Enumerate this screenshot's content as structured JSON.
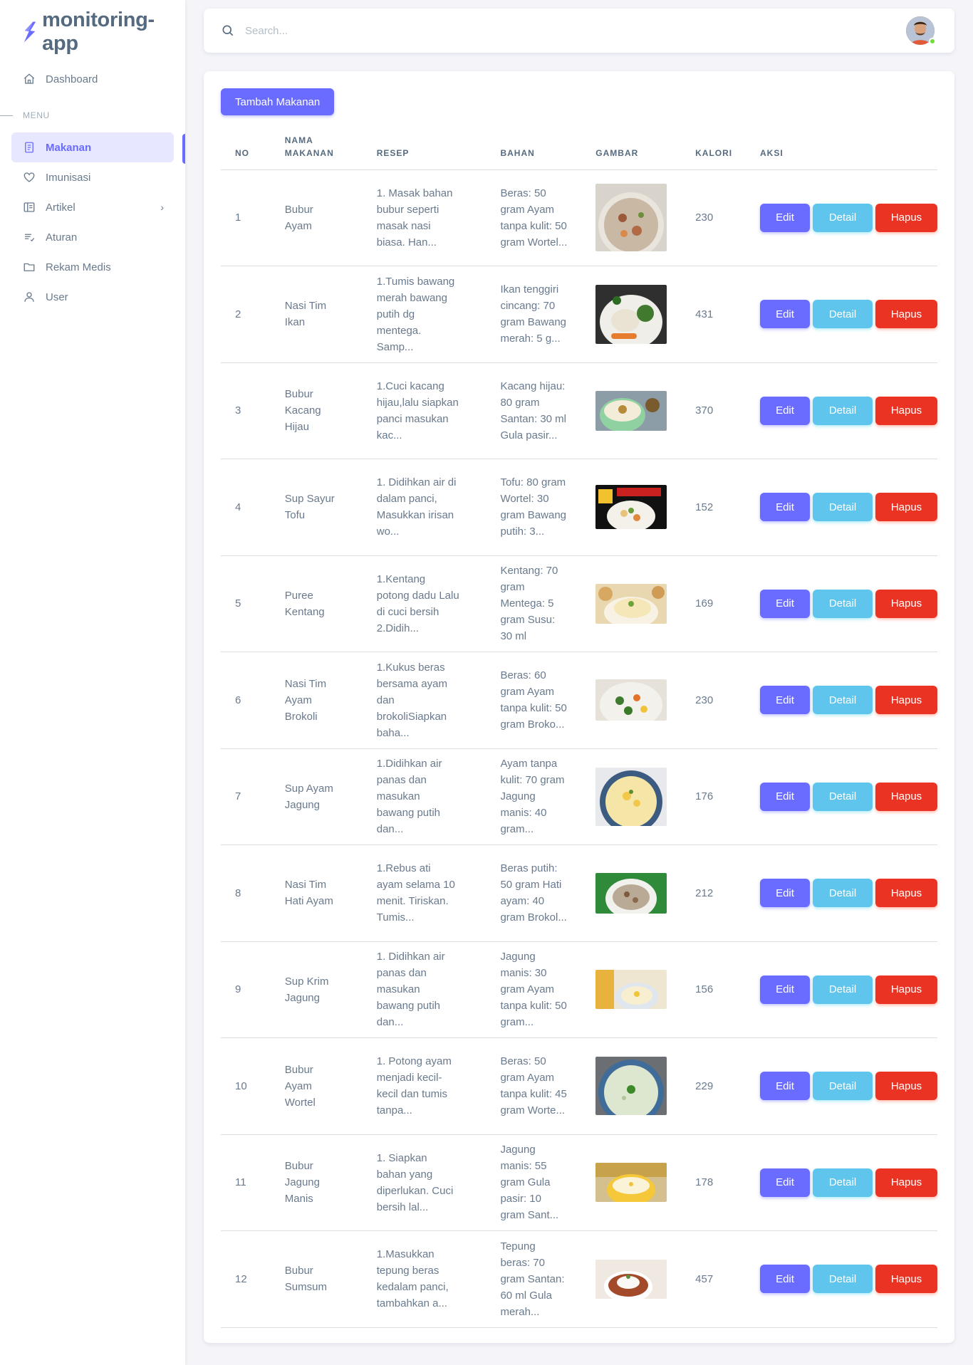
{
  "brand": {
    "name": "monitoring-app",
    "logo_icon": "bolt-s-logo-icon",
    "color": "#696cff"
  },
  "sidebar": {
    "dashboard": {
      "label": "Dashboard",
      "icon": "home-icon"
    },
    "menu_header": "MENU",
    "items": [
      {
        "label": "Makanan",
        "icon": "document-icon",
        "active": true
      },
      {
        "label": "Imunisasi",
        "icon": "heart-icon"
      },
      {
        "label": "Artikel",
        "icon": "book-icon",
        "has_submenu": true
      },
      {
        "label": "Aturan",
        "icon": "list-icon"
      },
      {
        "label": "Rekam Medis",
        "icon": "folder-icon"
      },
      {
        "label": "User",
        "icon": "user-icon"
      }
    ]
  },
  "navbar": {
    "search_placeholder": "Search...",
    "search_icon": "search-icon",
    "avatar": "user-avatar",
    "status": "online"
  },
  "main": {
    "add_button": "Tambah Makanan",
    "columns": [
      "NO",
      "NAMA MAKANAN",
      "RESEP",
      "BAHAN",
      "GAMBAR",
      "KALORI",
      "AKSI"
    ],
    "actions": {
      "edit": "Edit",
      "detail": "Detail",
      "delete": "Hapus"
    },
    "rows": [
      {
        "no": "1",
        "nama": "Bubur Ayam",
        "resep": "1. Masak bahan bubur seperti masak nasi biasa. Han...",
        "bahan": "Beras: 50 gram Ayam tanpa kulit: 50 gram Wortel...",
        "kalori": "230",
        "img": "porridge"
      },
      {
        "no": "2",
        "nama": "Nasi Tim Ikan",
        "resep": "1.Tumis bawang merah bawang putih dg mentega. Samp...",
        "bahan": "Ikan tenggiri cincang: 70 gram Bawang merah: 5 g...",
        "kalori": "431",
        "img": "plate"
      },
      {
        "no": "3",
        "nama": "Bubur Kacang Hijau",
        "resep": "1.Cuci kacang hijau,lalu siapkan panci masukan kac...",
        "bahan": "Kacang hijau: 80 gram Santan: 30 ml Gula pasir...",
        "kalori": "370",
        "img": "bowl-green"
      },
      {
        "no": "4",
        "nama": "Sup Sayur Tofu",
        "resep": "1. Didihkan air di dalam panci, Masukkan irisan wo...",
        "bahan": "Tofu: 80 gram Wortel: 30 gram Bawang putih: 3...",
        "kalori": "152",
        "img": "soup-dark"
      },
      {
        "no": "5",
        "nama": "Puree Kentang",
        "resep": "1.Kentang potong dadu Lalu di cuci bersih 2.Didih...",
        "bahan": "Kentang: 70 gram Mentega: 5 gram Susu: 30 ml",
        "kalori": "169",
        "img": "puree"
      },
      {
        "no": "6",
        "nama": "Nasi Tim Ayam Brokoli",
        "resep": "1.Kukus beras bersama ayam dan brokoliSiapkan baha...",
        "bahan": "Beras: 60 gram Ayam tanpa kulit: 50 gram Broko...",
        "kalori": "230",
        "img": "rice-veg"
      },
      {
        "no": "7",
        "nama": "Sup Ayam Jagung",
        "resep": "1.Didihkan air panas dan masukan bawang putih dan...",
        "bahan": "Ayam tanpa kulit: 70 gram Jagung manis: 40 gram...",
        "kalori": "176",
        "img": "corn-soup"
      },
      {
        "no": "8",
        "nama": "Nasi Tim Hati Ayam",
        "resep": "1.Rebus ati ayam selama 10 menit. Tiriskan. Tumis...",
        "bahan": "Beras putih: 50 gram Hati ayam: 40 gram Brokol...",
        "kalori": "212",
        "img": "liver"
      },
      {
        "no": "9",
        "nama": "Sup Krim Jagung",
        "resep": "1. Didihkan air panas dan masukan bawang putih dan...",
        "bahan": "Jagung manis: 30 gram Ayam tanpa kulit: 50 gram...",
        "kalori": "156",
        "img": "cream-corn"
      },
      {
        "no": "10",
        "nama": "Bubur Ayam Wortel",
        "resep": "1. Potong ayam menjadi kecil-kecil dan tumis tanpa...",
        "bahan": "Beras: 50 gram Ayam tanpa kulit: 45 gram Worte...",
        "kalori": "229",
        "img": "porridge-green"
      },
      {
        "no": "11",
        "nama": "Bubur Jagung Manis",
        "resep": "1. Siapkan bahan yang diperlukan. Cuci bersih lal...",
        "bahan": "Jagung manis: 55 gram Gula pasir: 10 gram Sant...",
        "kalori": "178",
        "img": "yellow-bowl"
      },
      {
        "no": "12",
        "nama": "Bubur Sumsum",
        "resep": "1.Masukkan tepung beras kedalam panci, tambahkan a...",
        "bahan": "Tepung beras: 70 gram Santan: 60 ml Gula merah...",
        "kalori": "457",
        "img": "sumsum"
      }
    ]
  }
}
